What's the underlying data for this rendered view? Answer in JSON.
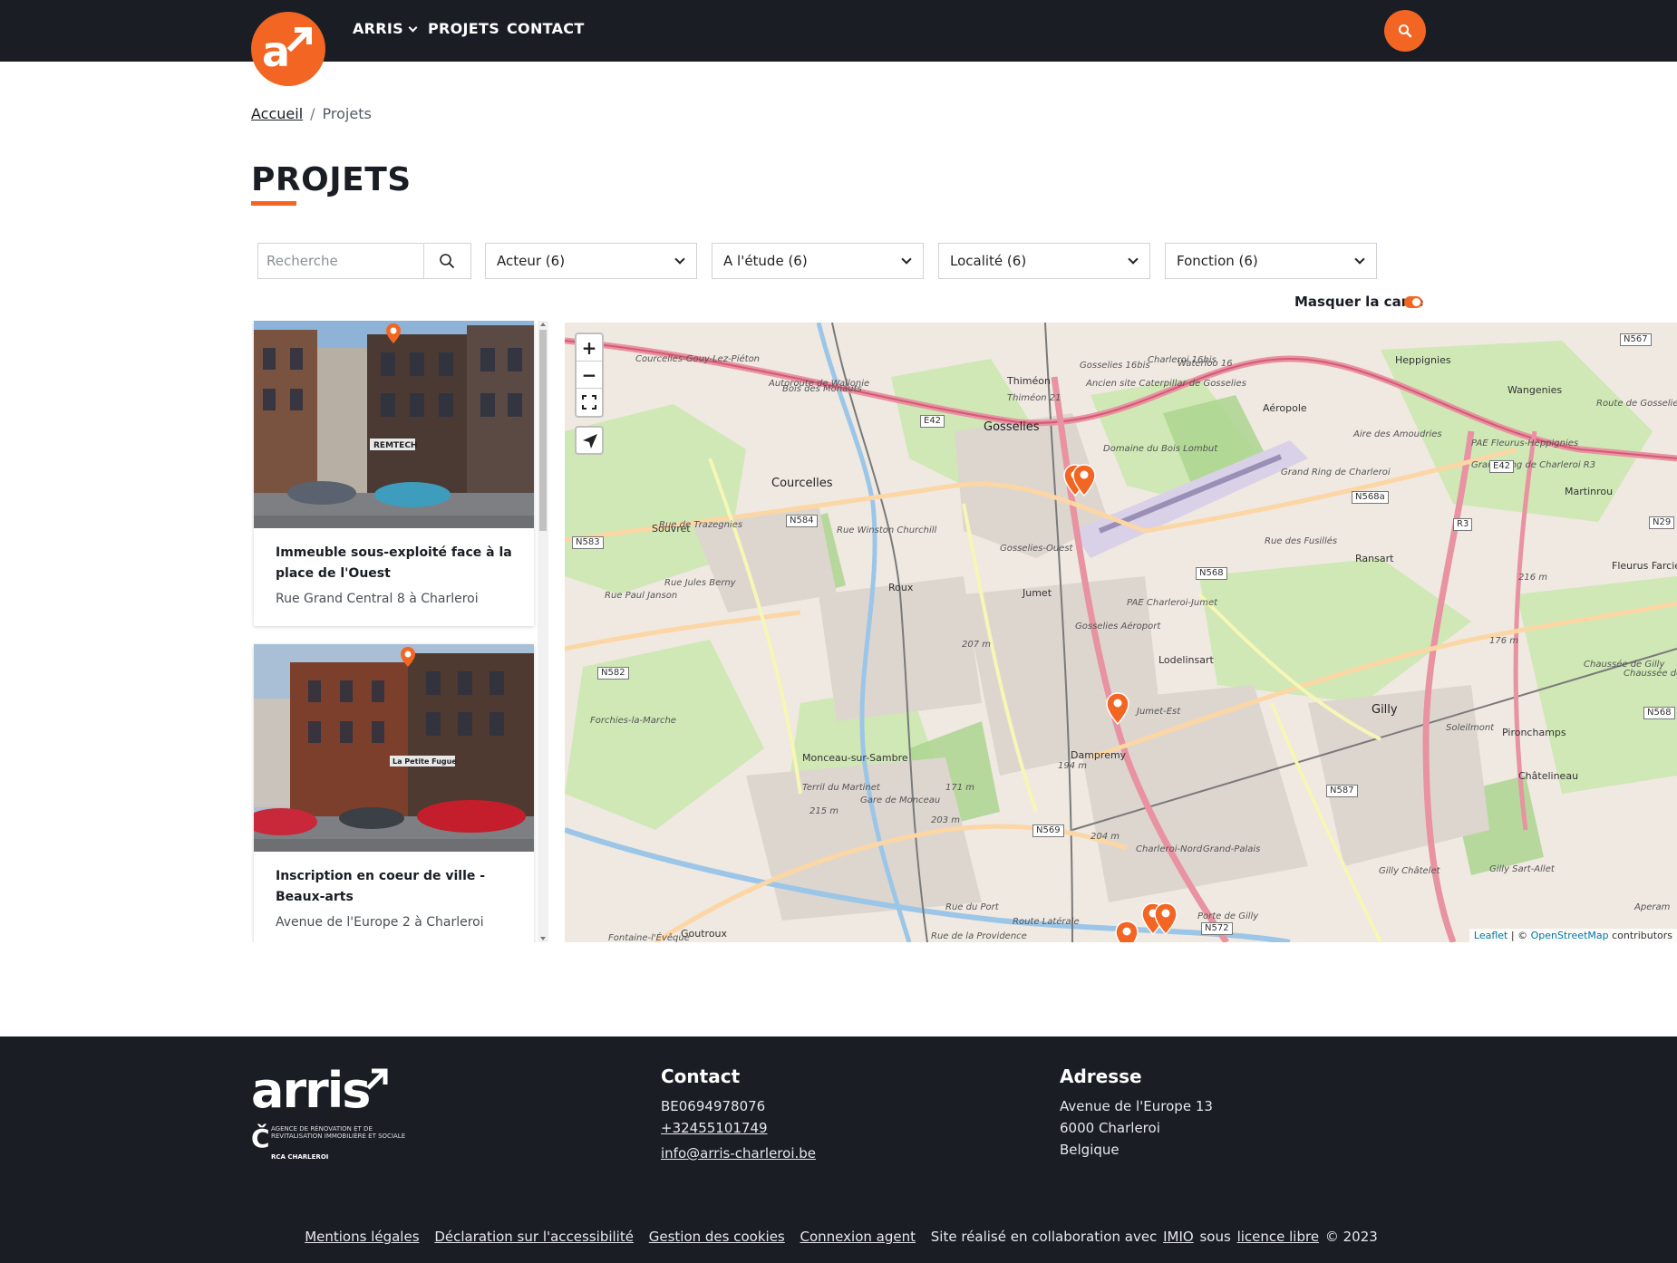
{
  "header": {
    "nav": [
      {
        "label": "ARRIS"
      },
      {
        "label": "PROJETS"
      },
      {
        "label": "CONTACT"
      }
    ]
  },
  "breadcrumb": {
    "home": "Accueil",
    "separator": "/",
    "current": "Projets"
  },
  "page_title": "PROJETS",
  "filters": {
    "search_placeholder": "Recherche",
    "selects": [
      "Acteur (6)",
      "A l'étude (6)",
      "Localité (6)",
      "Fonction (6)"
    ],
    "toggle_label": "Masquer la carte"
  },
  "projects": [
    {
      "title": "Immeuble sous-exploité face à la place de l'Ouest",
      "address": "Rue Grand Central 8 à Charleroi",
      "shop_sign": "REMTECH"
    },
    {
      "title": "Inscription en coeur de ville - Beaux-arts",
      "address": "Avenue de l'Europe 2 à Charleroi",
      "shop_sign": "La Petite Fugue"
    }
  ],
  "map": {
    "zoom_in": "+",
    "zoom_out": "−",
    "attribution": {
      "leaflet": "Leaflet",
      "sep": " | © ",
      "osm": "OpenStreetMap",
      "rest": " contributors"
    },
    "labels": [
      "Gosselies",
      "Courcelles",
      "Roux",
      "Jumet",
      "Lodelinsart",
      "Gilly",
      "Dampremy",
      "Ransart",
      "Heppignies",
      "Wangenies",
      "Souvret",
      "Monceau-sur-Sambre",
      "Châtelineau",
      "Pironchamps",
      "Thiméon",
      "Aéropole",
      "Martinrou",
      "Fleurus Farciennes",
      "Courcelles-Gouy-Lez-Piéton",
      "Autoroute de Wallonie",
      "Bois des Monauts",
      "Ancien site Caterpillar de Gosselies",
      "Domaine du Bois Lombut",
      "PAE Fleurus-Heppignies",
      "PAE Charleroi-Jumet",
      "Gosselies-Ouest",
      "Gosselies Aéroport",
      "Jumet-Est",
      "Charleroi-Nord",
      "Grand-Palais",
      "Porte de Gilly",
      "Terril du Martinet",
      "Gare de Monceau",
      "Goutroux",
      "Rue de Trazegnies",
      "Rue Winston Churchill",
      "Rue des Fusillés",
      "Aire des Amoudries",
      "Grand Ring de Charleroi",
      "Chaussée de Gilly",
      "Forchies-la-Marche",
      "Fontaine-l'Évêque",
      "Rue du Port",
      "Route Latérale",
      "Rue de la Providence",
      "Chaussée de Lambusart",
      "Soleilmont",
      "Gilly Sart-Allet",
      "Gilly Châtelet",
      "Aperam",
      "Thiméon 21",
      "Gosselies 16bis",
      "Charleroi 16bis",
      "Waterloo 16",
      "Route de Gosselies",
      "Rue Jules Berny",
      "Rue Paul Janson",
      "Grand Ring de Charleroi R3"
    ],
    "road_refs": [
      "E42",
      "N584",
      "N583",
      "N582",
      "N568",
      "N568a",
      "R3",
      "N29",
      "N567",
      "N587",
      "N569",
      "N572"
    ],
    "heights": [
      "207 m",
      "216 m",
      "176 m",
      "194 m",
      "171 m",
      "203 m",
      "204 m",
      "215 m"
    ]
  },
  "footer": {
    "logo_text": "arris",
    "logo_sub": "AGENCE DE RÉNOVATION ET DE REVITALISATION IMMOBILIÈRE ET SOCIALE",
    "logo_rca": "RCA CHARLEROI",
    "contact_title": "Contact",
    "contact_vat": "BE0694978076",
    "contact_phone": "+32455101749",
    "contact_email": "info@arris-charleroi.be",
    "address_title": "Adresse",
    "address_street": "Avenue de l'Europe 13",
    "address_city": "6000 Charleroi",
    "address_country": "Belgique",
    "links": [
      "Mentions légales",
      "Déclaration sur l'accessibilité",
      "Gestion des cookies",
      "Connexion agent"
    ],
    "credit_prefix": "Site réalisé en collaboration avec",
    "credit_imio": "IMIO",
    "credit_mid": "sous",
    "credit_licence": "licence libre",
    "credit_year": "© 2023"
  },
  "colors": {
    "accent": "#f26522",
    "dark": "#1a1d24"
  }
}
